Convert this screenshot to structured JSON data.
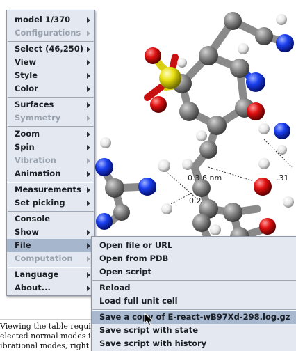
{
  "viewer": {
    "distance_labels": [
      "0.3 6 nm",
      "0.2",
      ".31"
    ]
  },
  "main_menu": {
    "items": [
      {
        "label": "model 1/370",
        "enabled": true,
        "submenu": true
      },
      {
        "label": "Configurations",
        "enabled": false,
        "submenu": true
      },
      {
        "label": "Select (46,250)",
        "enabled": true,
        "submenu": true
      },
      {
        "label": "View",
        "enabled": true,
        "submenu": true
      },
      {
        "label": "Style",
        "enabled": true,
        "submenu": true
      },
      {
        "label": "Color",
        "enabled": true,
        "submenu": true
      },
      {
        "label": "Surfaces",
        "enabled": true,
        "submenu": true
      },
      {
        "label": "Symmetry",
        "enabled": false,
        "submenu": true
      },
      {
        "label": "Zoom",
        "enabled": true,
        "submenu": true
      },
      {
        "label": "Spin",
        "enabled": true,
        "submenu": true
      },
      {
        "label": "Vibration",
        "enabled": false,
        "submenu": true
      },
      {
        "label": "Animation",
        "enabled": true,
        "submenu": true
      },
      {
        "label": "Measurements",
        "enabled": true,
        "submenu": true
      },
      {
        "label": "Set picking",
        "enabled": true,
        "submenu": true
      },
      {
        "label": "Console",
        "enabled": true,
        "submenu": false
      },
      {
        "label": "Show",
        "enabled": true,
        "submenu": true
      },
      {
        "label": "File",
        "enabled": true,
        "submenu": true,
        "highlighted": true
      },
      {
        "label": "Computation",
        "enabled": false,
        "submenu": true
      },
      {
        "label": "Language",
        "enabled": true,
        "submenu": true
      },
      {
        "label": "About...",
        "enabled": true,
        "submenu": true
      }
    ]
  },
  "file_submenu": {
    "items": [
      {
        "label": "Open file or URL"
      },
      {
        "label": "Open from PDB"
      },
      {
        "label": "Open script"
      },
      {
        "label": "Reload"
      },
      {
        "label": "Load full unit cell"
      },
      {
        "label": "Save a copy of E-react-wB97Xd-298.log.gz",
        "highlighted": true
      },
      {
        "label": "Save script with state"
      },
      {
        "label": "Save script with history"
      }
    ]
  },
  "doc_text": {
    "line1": "Viewing the table requir",
    "line2": "elected normal modes is",
    "line3": "ibrational modes, right c"
  },
  "colors": {
    "menu_bg": "#e4e9f1",
    "highlight": "#a6b6cc",
    "carbon": "#8c8c8c",
    "oxygen": "#e01010",
    "nitrogen": "#1a3ff0",
    "sulfur": "#e8e010",
    "hydrogen": "#f2f2f2"
  }
}
